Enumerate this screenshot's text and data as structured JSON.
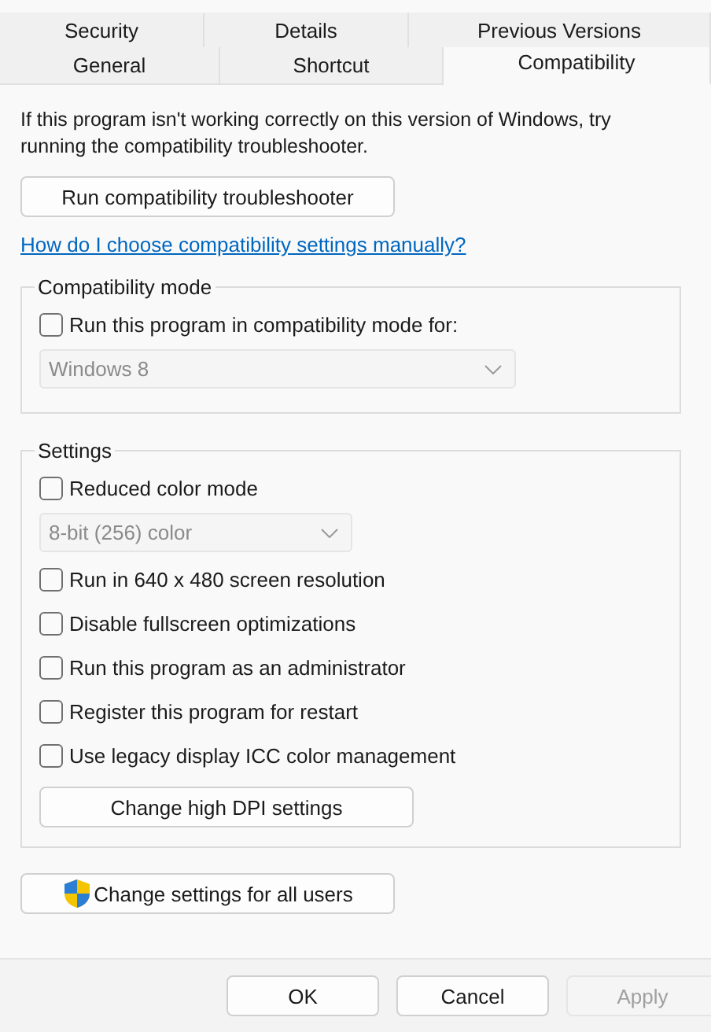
{
  "tab_rows": [
    [
      {
        "label": "Security",
        "selected": false
      },
      {
        "label": "Details",
        "selected": false
      },
      {
        "label": "Previous Versions",
        "selected": false
      }
    ],
    [
      {
        "label": "General",
        "selected": false
      },
      {
        "label": "Shortcut",
        "selected": false
      },
      {
        "label": "Compatibility",
        "selected": true
      }
    ]
  ],
  "intro": "If this program isn't working correctly on this version of Windows, try running the compatibility troubleshooter.",
  "troubleshooter_button": "Run compatibility troubleshooter",
  "help_link": "How do I choose compatibility settings manually?",
  "compatibility_mode": {
    "title": "Compatibility mode",
    "items": [
      {
        "kind": "checkbox",
        "label": "Run this program in compatibility mode for:",
        "checked": false
      },
      {
        "kind": "dropdown",
        "value": "Windows 8",
        "disabled": true
      }
    ]
  },
  "settings": {
    "title": "Settings",
    "items": [
      {
        "kind": "checkbox",
        "label": "Reduced color mode",
        "checked": false
      },
      {
        "kind": "dropdown",
        "value": "8-bit (256) color",
        "disabled": true
      },
      {
        "kind": "checkbox",
        "label": "Run in 640 x 480 screen resolution",
        "checked": false
      },
      {
        "kind": "checkbox",
        "label": "Disable fullscreen optimizations",
        "checked": false
      },
      {
        "kind": "checkbox",
        "label": "Run this program as an administrator",
        "checked": false
      },
      {
        "kind": "checkbox",
        "label": "Register this program for restart",
        "checked": false
      },
      {
        "kind": "checkbox",
        "label": "Use legacy display ICC color management",
        "checked": false
      },
      {
        "kind": "button",
        "label": "Change high DPI settings"
      }
    ]
  },
  "all_users_button": "Change settings for all users",
  "footer_buttons": [
    {
      "label": "OK",
      "disabled": false
    },
    {
      "label": "Cancel",
      "disabled": false
    },
    {
      "label": "Apply",
      "disabled": true
    }
  ]
}
